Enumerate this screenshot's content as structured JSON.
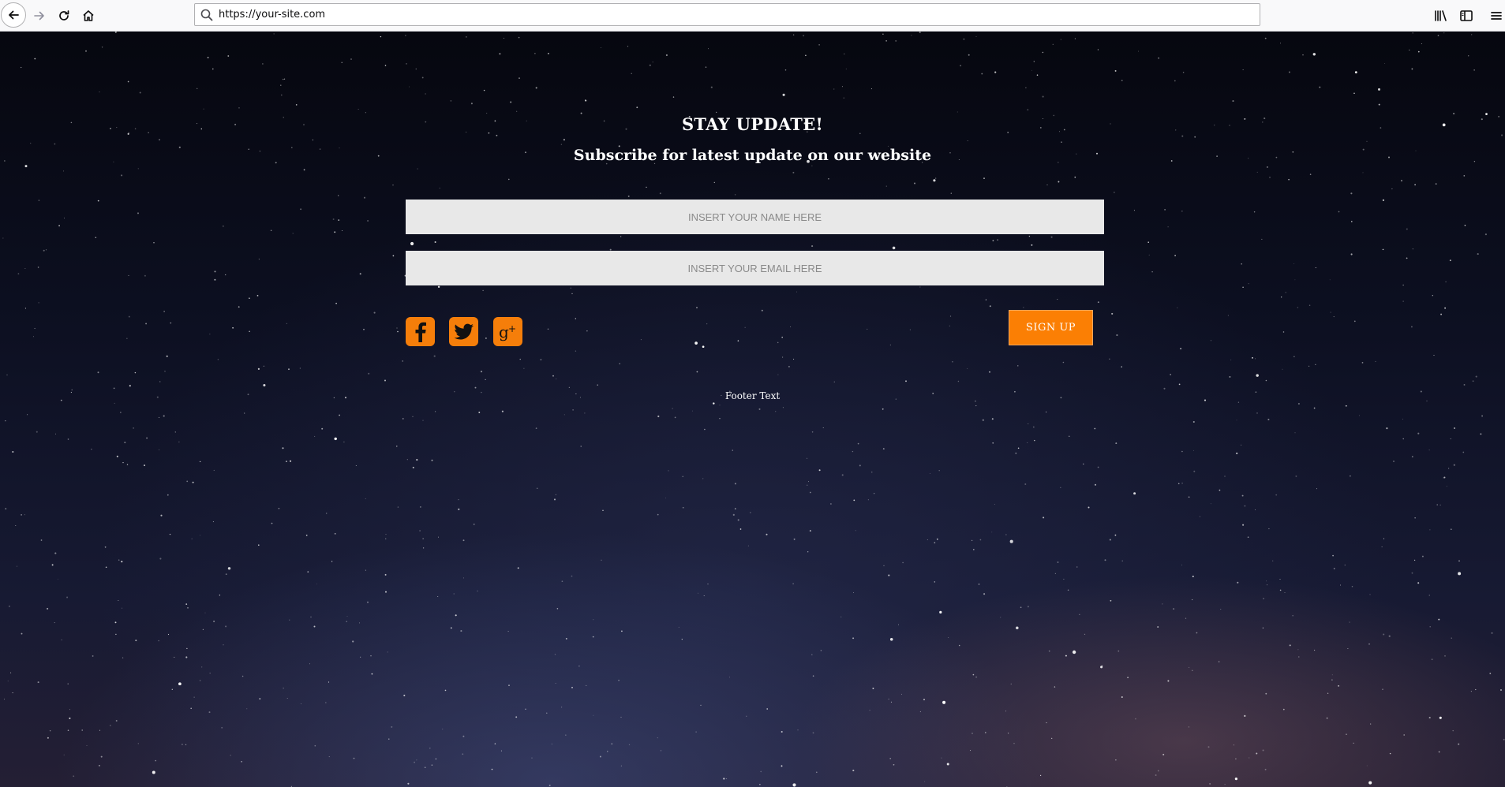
{
  "browser": {
    "url": "https://your-site.com",
    "icons": {
      "back": "arrow-left-icon",
      "forward": "arrow-right-icon",
      "reload": "reload-icon",
      "home": "home-icon",
      "search": "search-icon",
      "library": "library-icon",
      "sidebar": "sidebar-icon",
      "menu": "hamburger-menu-icon"
    }
  },
  "page": {
    "title": "STAY UPDATE!",
    "subtitle": "Subscribe for latest update on our website",
    "name_field": {
      "placeholder": "INSERT YOUR NAME HERE",
      "value": ""
    },
    "email_field": {
      "placeholder": "INSERT YOUR EMAIL HERE",
      "value": ""
    },
    "social": [
      {
        "name": "facebook",
        "icon": "facebook-icon"
      },
      {
        "name": "twitter",
        "icon": "twitter-icon"
      },
      {
        "name": "google-plus",
        "icon": "google-plus-icon"
      }
    ],
    "signup_label": "SIGN UP",
    "footer": "Footer Text"
  },
  "colors": {
    "accent": "#fb7f04",
    "field_bg": "#e8e8e8",
    "text": "#ffffff",
    "sky_dark": "#06070f"
  }
}
